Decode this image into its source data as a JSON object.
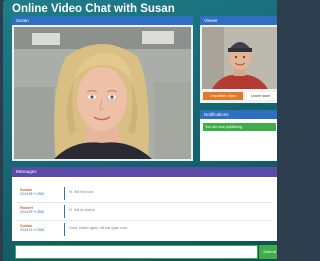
{
  "app": {
    "title": "Online Video Chat with Susan"
  },
  "susan_panel": {
    "title": "Susan"
  },
  "viewer_panel": {
    "title": "Viewer",
    "unpublish_label": "Unpublish video",
    "leave_label": "Leave room"
  },
  "notifications": {
    "title": "Notifications",
    "items": [
      "You are now publishing"
    ]
  },
  "messages": {
    "title": "Messages",
    "items": [
      {
        "name": "Susan",
        "time": "20:44:08 +/-0500",
        "text": "Hi, Will that work"
      },
      {
        "name": "Robert",
        "time": "20:44:09 +/-0500",
        "text": "Hi. Will be doable"
      },
      {
        "name": "Susan",
        "time": "20:44:15 +/-0500",
        "text": "Great, thanks again, will talk again soon"
      }
    ]
  },
  "compose": {
    "placeholder": "",
    "submit_label": "Submit"
  },
  "colors": {
    "header_blue": "#2f6fc0",
    "messages_purple": "#5b4aa8",
    "accent_orange": "#e07a2a",
    "success_green": "#3fae49",
    "background_teal": "#1f7d8b"
  }
}
